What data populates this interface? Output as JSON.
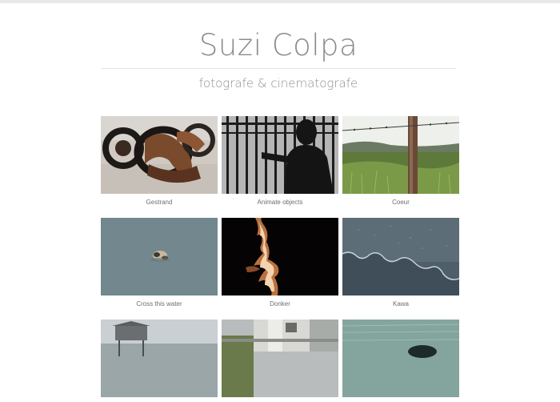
{
  "site": {
    "title": "Suzi Colpa",
    "tagline": "fotografe & cinematografe"
  },
  "gallery": {
    "items": [
      {
        "caption": "Gestrand",
        "icon": "rusted-sculpture-photo"
      },
      {
        "caption": "Animate objects",
        "icon": "silhouette-gate-photo"
      },
      {
        "caption": "Coeur",
        "icon": "fence-field-photo"
      },
      {
        "caption": "Cross this water",
        "icon": "water-object-photo"
      },
      {
        "caption": "Donker",
        "icon": "fire-dark-photo"
      },
      {
        "caption": "Kawa",
        "icon": "wet-surface-photo"
      },
      {
        "caption": "",
        "icon": "stilt-house-photo"
      },
      {
        "caption": "",
        "icon": "building-photo"
      },
      {
        "caption": "",
        "icon": "sea-photo"
      }
    ]
  }
}
